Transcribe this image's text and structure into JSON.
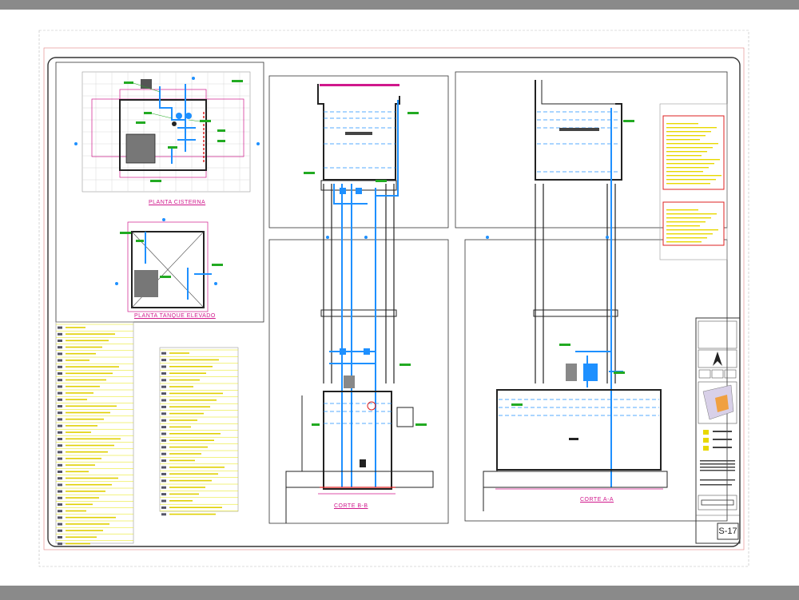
{
  "sheet": {
    "number": "S-17"
  },
  "views": {
    "planta_cisterna": {
      "title": "PLANTA CISTERNA"
    },
    "planta_tanque": {
      "title": "PLANTA TANQUE ELEVADO"
    },
    "corte_b": {
      "title": "CORTE B-B"
    },
    "corte_a": {
      "title": "CORTE A-A"
    }
  },
  "colors": {
    "band": "#8a8a8a",
    "frame": "#333333",
    "magenta": "#d0188c",
    "cyan": "#1e90ff",
    "yellow": "#f0f000",
    "green": "#22aa22",
    "red": "#dd2222",
    "grid": "#d8d8d8"
  }
}
